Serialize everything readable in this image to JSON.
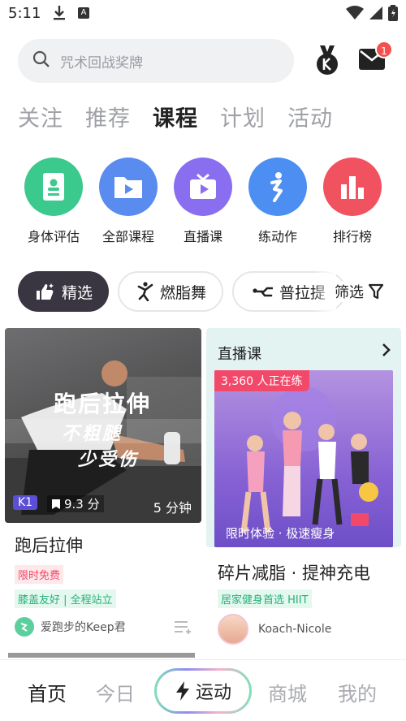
{
  "status": {
    "time": "5:11",
    "a_label": "A"
  },
  "search": {
    "placeholder": "咒术回战奖牌"
  },
  "notifications": {
    "badge": "1"
  },
  "tabs": [
    "关注",
    "推荐",
    "课程",
    "计划",
    "活动"
  ],
  "categories": [
    {
      "label": "身体评估",
      "color": "#3bc98d",
      "icon": "body-assessment-icon"
    },
    {
      "label": "全部课程",
      "color": "#5a8cf0",
      "icon": "folder-play-icon"
    },
    {
      "label": "直播课",
      "color": "#8a6ef0",
      "icon": "tv-live-icon"
    },
    {
      "label": "练动作",
      "color": "#4c8ef2",
      "icon": "exercise-figure-icon"
    },
    {
      "label": "排行榜",
      "color": "#f0525f",
      "icon": "bar-chart-icon"
    }
  ],
  "filters": {
    "chips": [
      "精选",
      "燃脂舞",
      "普拉提"
    ],
    "filter_label": "筛选"
  },
  "card1": {
    "banner_line1": "跑后拉伸",
    "banner_line2": "不粗腿",
    "banner_line3": "少受伤",
    "level": "K1",
    "rating": "9.3 分",
    "duration": "5 分钟",
    "title": "跑后拉伸",
    "tag_red": "限时免费",
    "tag_green": "膝盖友好 | 全程站立",
    "author": "爱跑步的Keep君"
  },
  "card2": {
    "section": "直播课",
    "live_count": "3,360 人正在练",
    "caption": "限时体验 · 极速瘦身",
    "title": "碎片减脂 · 提神充电",
    "tag": "居家健身首选 HIIT",
    "author": "Koach-Nicole"
  },
  "nav": {
    "home": "首页",
    "today": "今日",
    "sport": "运动",
    "mall": "商城",
    "mine": "我的"
  }
}
